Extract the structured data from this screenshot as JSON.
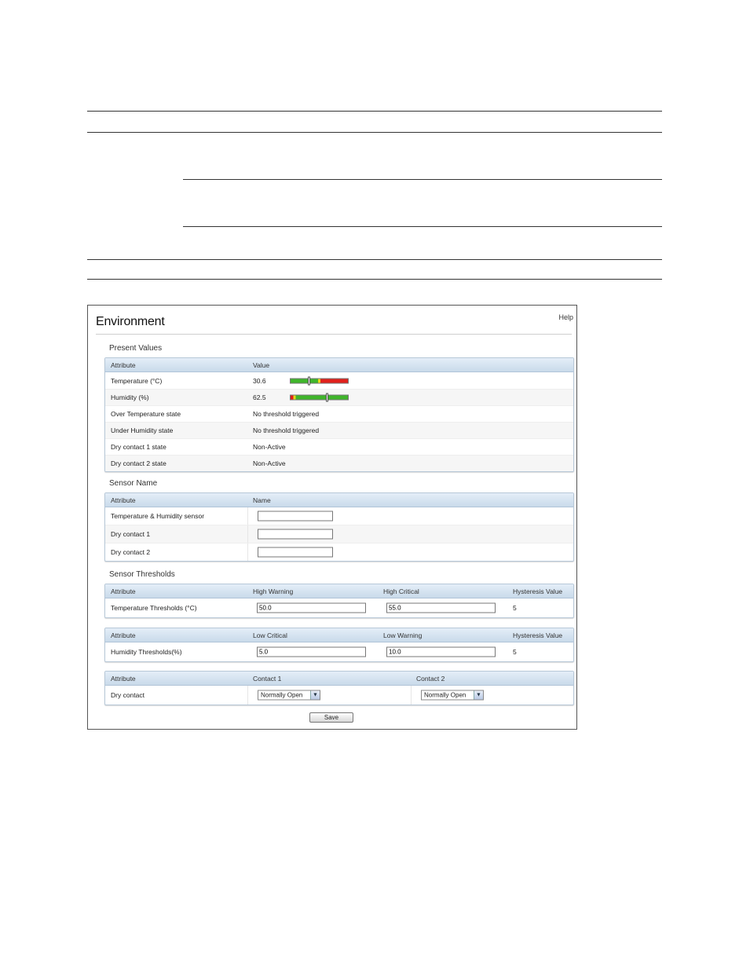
{
  "panel": {
    "title": "Environment",
    "help": "Help"
  },
  "present_values": {
    "title": "Present Values",
    "headers": [
      "Attribute",
      "Value"
    ],
    "rows": [
      {
        "attribute": "Temperature (°C)",
        "value": "30.6"
      },
      {
        "attribute": "Humidity (%)",
        "value": "62.5"
      },
      {
        "attribute": "Over Temperature state",
        "value": "No threshold triggered"
      },
      {
        "attribute": "Under Humidity state",
        "value": "No threshold triggered"
      },
      {
        "attribute": "Dry contact 1 state",
        "value": "Non-Active"
      },
      {
        "attribute": "Dry contact 2 state",
        "value": "Non-Active"
      }
    ]
  },
  "sensor_name": {
    "title": "Sensor Name",
    "headers": [
      "Attribute",
      "Name"
    ],
    "rows": [
      {
        "attribute": "Temperature & Humidity sensor",
        "value": ""
      },
      {
        "attribute": "Dry contact 1",
        "value": ""
      },
      {
        "attribute": "Dry contact 2",
        "value": ""
      }
    ]
  },
  "sensor_thresholds": {
    "title": "Sensor Thresholds",
    "temperature": {
      "headers": [
        "Attribute",
        "High Warning",
        "High Critical",
        "Hysteresis Value"
      ],
      "attribute": "Temperature Thresholds (°C)",
      "high_warning": "50.0",
      "high_critical": "55.0",
      "hysteresis": "5"
    },
    "humidity": {
      "headers": [
        "Attribute",
        "Low Critical",
        "Low Warning",
        "Hysteresis Value"
      ],
      "attribute": "Humidity Thresholds(%)",
      "low_critical": "5.0",
      "low_warning": "10.0",
      "hysteresis": "5"
    },
    "dry_contact": {
      "headers": [
        "Attribute",
        "Contact 1",
        "Contact 2"
      ],
      "attribute": "Dry contact",
      "contact1": "Normally Open",
      "contact2": "Normally Open"
    }
  },
  "save_label": "Save",
  "colors": {
    "bar_green": "#3fb52b",
    "bar_yellow": "#e8d619",
    "bar_red": "#e0201b",
    "header_blue": "#c9daea"
  }
}
